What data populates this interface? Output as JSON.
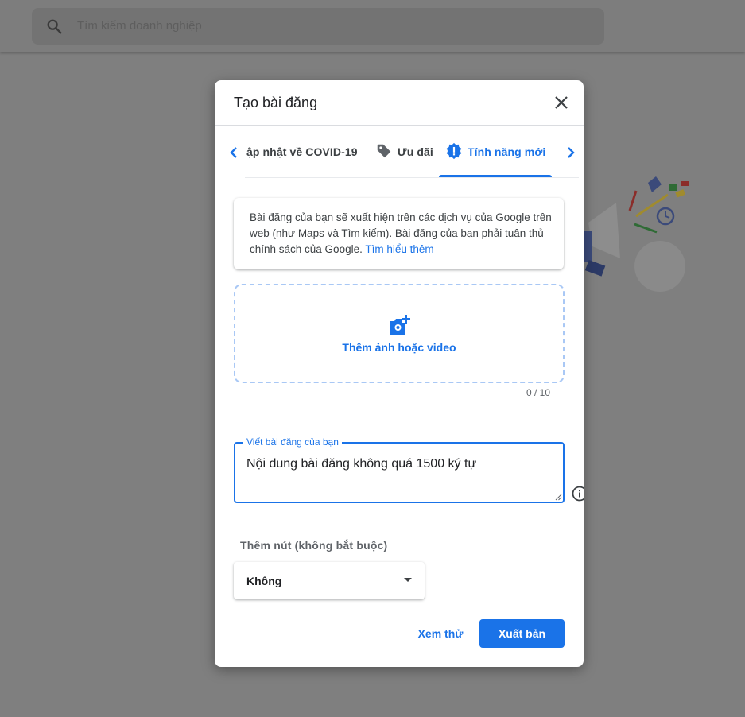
{
  "search": {
    "placeholder": "Tìm kiếm doanh nghiệp",
    "icon": "search-icon"
  },
  "dialog": {
    "title": "Tạo bài đăng",
    "close_icon": "close-icon",
    "tabs": [
      {
        "label": "ập nhật về COVID-19",
        "icon": ""
      },
      {
        "label": "Ưu đãi",
        "icon": "tag-icon"
      },
      {
        "label": "Tính năng mới",
        "icon": "alert-badge-icon",
        "selected": true
      }
    ],
    "info": {
      "text": "Bài đăng của bạn sẽ xuất hiện trên các dịch vụ của Google trên web (như Maps và Tìm kiếm). Bài đăng của bạn phải tuân thủ chính sách của Google.",
      "link": "Tìm hiểu thêm"
    },
    "upload": {
      "label": "Thêm ảnh hoặc video",
      "counter": "0 / 10"
    },
    "post": {
      "label": "Viết bài đăng của bạn",
      "value": "Nội dung bài đăng không quá 1500 ký tự"
    },
    "button_section": {
      "label": "Thêm nút (không bắt buộc)",
      "selected": "Không"
    },
    "actions": {
      "preview": "Xem thử",
      "publish": "Xuất bản"
    }
  },
  "colors": {
    "accent": "#1a73e8",
    "scrim": "#7f7f7f",
    "text": "#202124"
  }
}
